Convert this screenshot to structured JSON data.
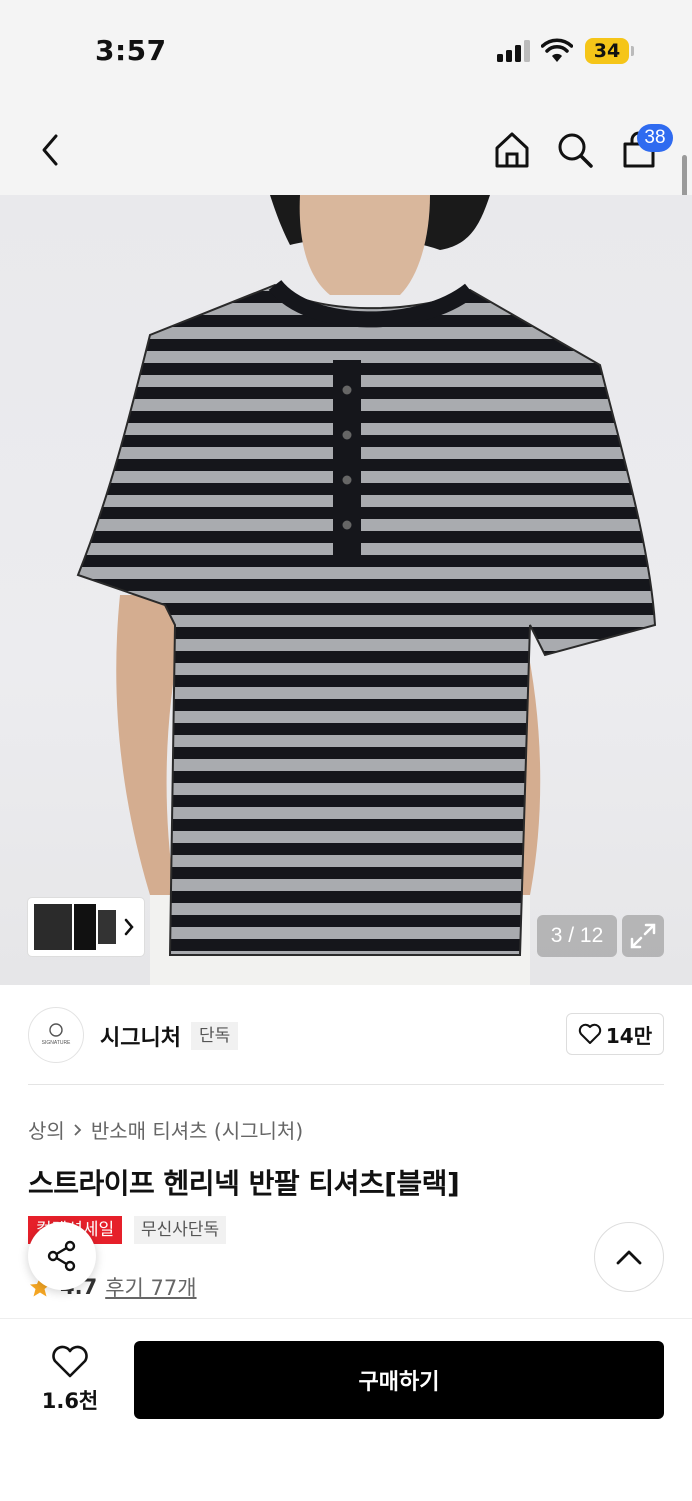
{
  "status": {
    "time": "3:57",
    "battery": "34"
  },
  "nav": {
    "back_icon": "chevron-left-icon",
    "home_icon": "home-icon",
    "search_icon": "search-icon",
    "cart_icon": "shopping-bag-icon",
    "cart_count": "38"
  },
  "gallery": {
    "counter": "3 / 12",
    "expand_icon": "expand-icon"
  },
  "brand": {
    "logo_text": "SIGNATURE",
    "name": "시그니처",
    "tag": "단독",
    "follow_count": "14만"
  },
  "product": {
    "breadcrumb": [
      "상의",
      "반소매 티셔츠 (시그니처)"
    ],
    "title": "스트라이프 헨리넥 반팔 티셔츠[블랙]",
    "badge_sale": "컬렉션세일",
    "badge_exclusive": "무신사단독",
    "rating": "4.7",
    "reviews": "후기 77개"
  },
  "bottom": {
    "wish_count": "1.6천",
    "buy_label": "구매하기"
  },
  "colors": {
    "accent_blue": "#2f6bf0",
    "sale_red": "#e6202a",
    "rating_star": "#f5a623"
  }
}
